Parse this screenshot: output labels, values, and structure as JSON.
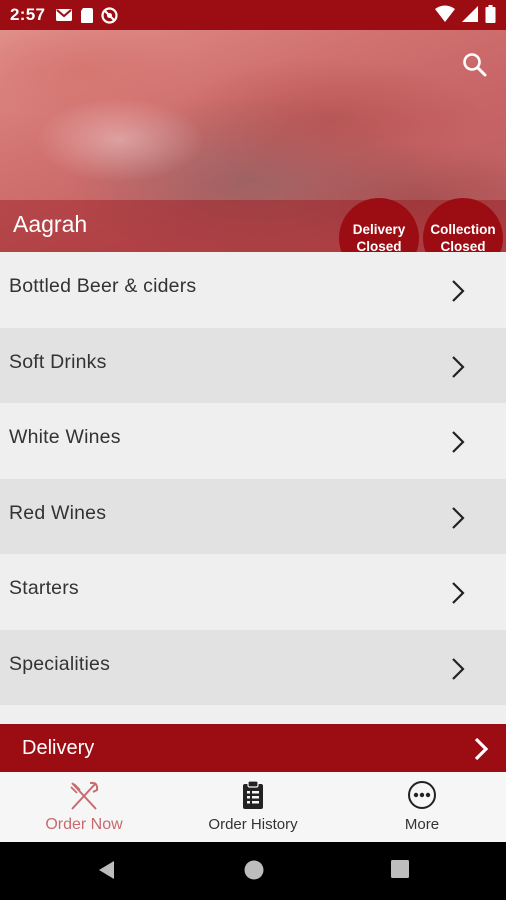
{
  "status_bar": {
    "time": "2:57"
  },
  "header": {
    "restaurant_name": "Aagrah"
  },
  "badges": {
    "delivery": "Delivery Closed",
    "collection": "Collection Closed"
  },
  "menu": {
    "categories": [
      "Bottled Beer & ciders",
      "Soft Drinks",
      "White Wines",
      "Red Wines",
      "Starters",
      "Specialities"
    ]
  },
  "delivery_bar": {
    "label": "Delivery"
  },
  "tabs": [
    {
      "label": "Order Now",
      "icon": "fork-knife-icon",
      "active": true
    },
    {
      "label": "Order History",
      "icon": "clipboard-icon",
      "active": false
    },
    {
      "label": "More",
      "icon": "more-icon",
      "active": false
    }
  ],
  "colors": {
    "brand": "#9c0d13",
    "active_tab": "#c86a6e"
  }
}
